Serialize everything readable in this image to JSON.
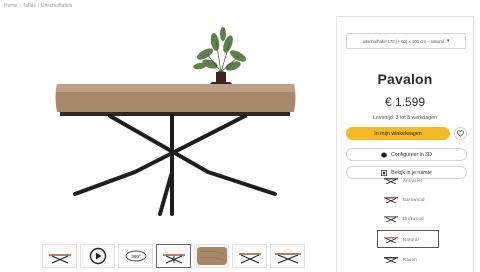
{
  "breadcrumb": [
    "Home",
    "Tafels",
    "Uitschuiftafels"
  ],
  "product": {
    "variant": "uitschuiftafel 170 (+ 60) x 100 cm – natural",
    "title": "Pavalon",
    "price": "€ 1.599",
    "delivery": "Levertijd: 3 tot 8 werkdagen"
  },
  "buttons": {
    "cart": "In mijn winkelwagen",
    "configure": "Configureer in 3D",
    "room": "Bekijk in je ruimte"
  },
  "swatches": [
    {
      "label": "Antraciet",
      "selected": false
    },
    {
      "label": "Barnwood",
      "selected": false
    },
    {
      "label": "Driftwood",
      "selected": false
    },
    {
      "label": "Natural",
      "selected": true
    },
    {
      "label": "Raven",
      "selected": false
    }
  ],
  "thumbnails": [
    "table-front",
    "video-play",
    "view-360",
    "table-side",
    "table-top",
    "table-angle",
    "table-extended"
  ],
  "colors": {
    "accent": "#f5b922",
    "border": "#d4d4d4"
  }
}
